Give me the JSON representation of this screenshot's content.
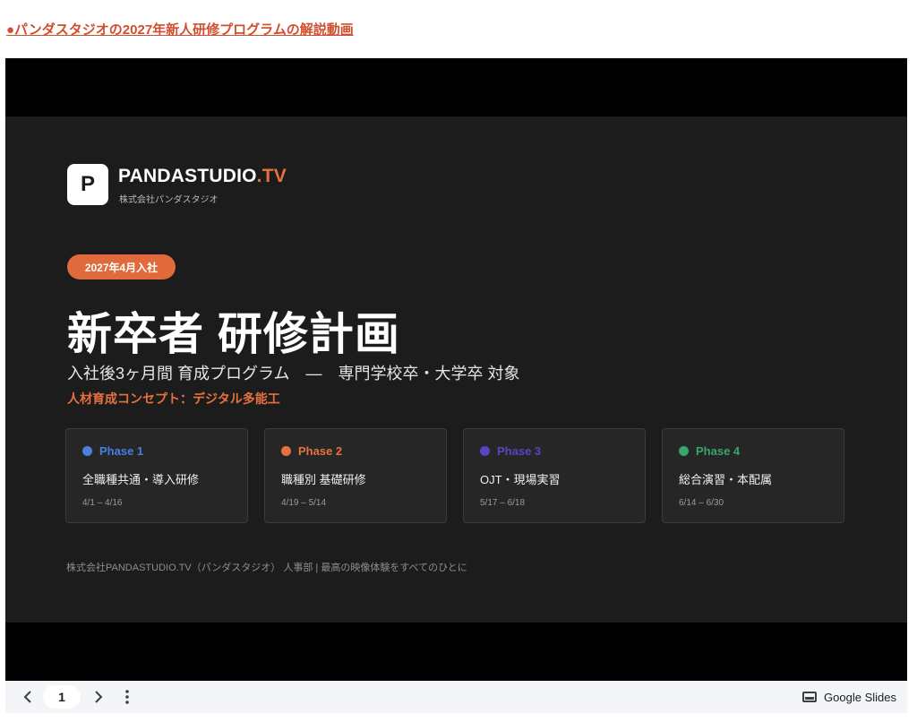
{
  "page": {
    "link_text": "●パンダスタジオの2027年新人研修プログラムの解説動画"
  },
  "slide": {
    "logo_letter": "P",
    "brand_main": "PANDASTUDIO",
    "brand_accent": ".TV",
    "brand_sub": "株式会社パンダスタジオ",
    "badge": "2027年4月入社",
    "title": "新卒者 研修計画",
    "subtitle": "入社後3ヶ月間 育成プログラム　―　専門学校卒・大学卒 対象",
    "concept": "人材育成コンセプト：デジタル多能工",
    "phases": [
      {
        "label": "Phase 1",
        "name": "全職種共通・導入研修",
        "dates": "4/1 – 4/16",
        "color": "#4a7fe0"
      },
      {
        "label": "Phase 2",
        "name": "職種別 基礎研修",
        "dates": "4/19 – 5/14",
        "color": "#e8703f"
      },
      {
        "label": "Phase 3",
        "name": "OJT・現場実習",
        "dates": "5/17 – 6/18",
        "color": "#5a44c4"
      },
      {
        "label": "Phase 4",
        "name": "総合演習・本配属",
        "dates": "6/14 – 6/30",
        "color": "#3aa56a"
      }
    ],
    "footer": "株式会社PANDASTUDIO.TV（パンダスタジオ）  人事部  |  最高の映像体験をすべてのひとに"
  },
  "toolbar": {
    "prev_icon": "chevron-left-icon",
    "page_number": "1",
    "next_icon": "chevron-right-icon",
    "more_icon": "more-vert-icon",
    "brand_label": "Google Slides"
  },
  "colors": {
    "accent": "#e06a3b",
    "slide_bg": "#1c1c1c",
    "link": "#d04e2e"
  }
}
